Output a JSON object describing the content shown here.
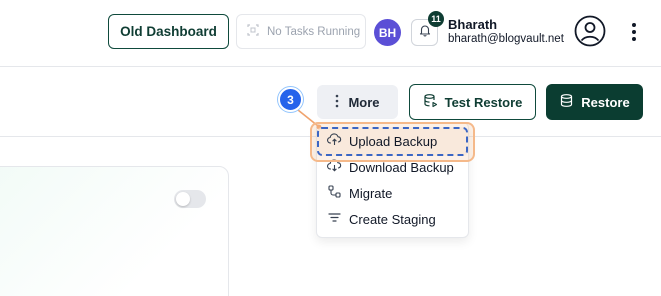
{
  "header": {
    "old_dashboard_label": "Old Dashboard",
    "tasks_status": "No Tasks Running",
    "avatar_initials": "BH",
    "notification_count": "11",
    "user_name": "Bharath",
    "user_email": "bharath@blogvault.net"
  },
  "actions": {
    "more_label": "More",
    "test_restore_label": "Test Restore",
    "restore_label": "Restore"
  },
  "step_marker": "3",
  "menu": {
    "items": [
      {
        "label": "Upload Backup",
        "icon": "cloud-upload-icon"
      },
      {
        "label": "Download Backup",
        "icon": "cloud-download-icon"
      },
      {
        "label": "Migrate",
        "icon": "migrate-icon"
      },
      {
        "label": "Create Staging",
        "icon": "filter-lines-icon"
      }
    ]
  },
  "colors": {
    "brand_dark": "#0b3d31",
    "avatar": "#5b4fd6",
    "step_marker": "#2563eb",
    "highlight": "#f5b98a"
  }
}
